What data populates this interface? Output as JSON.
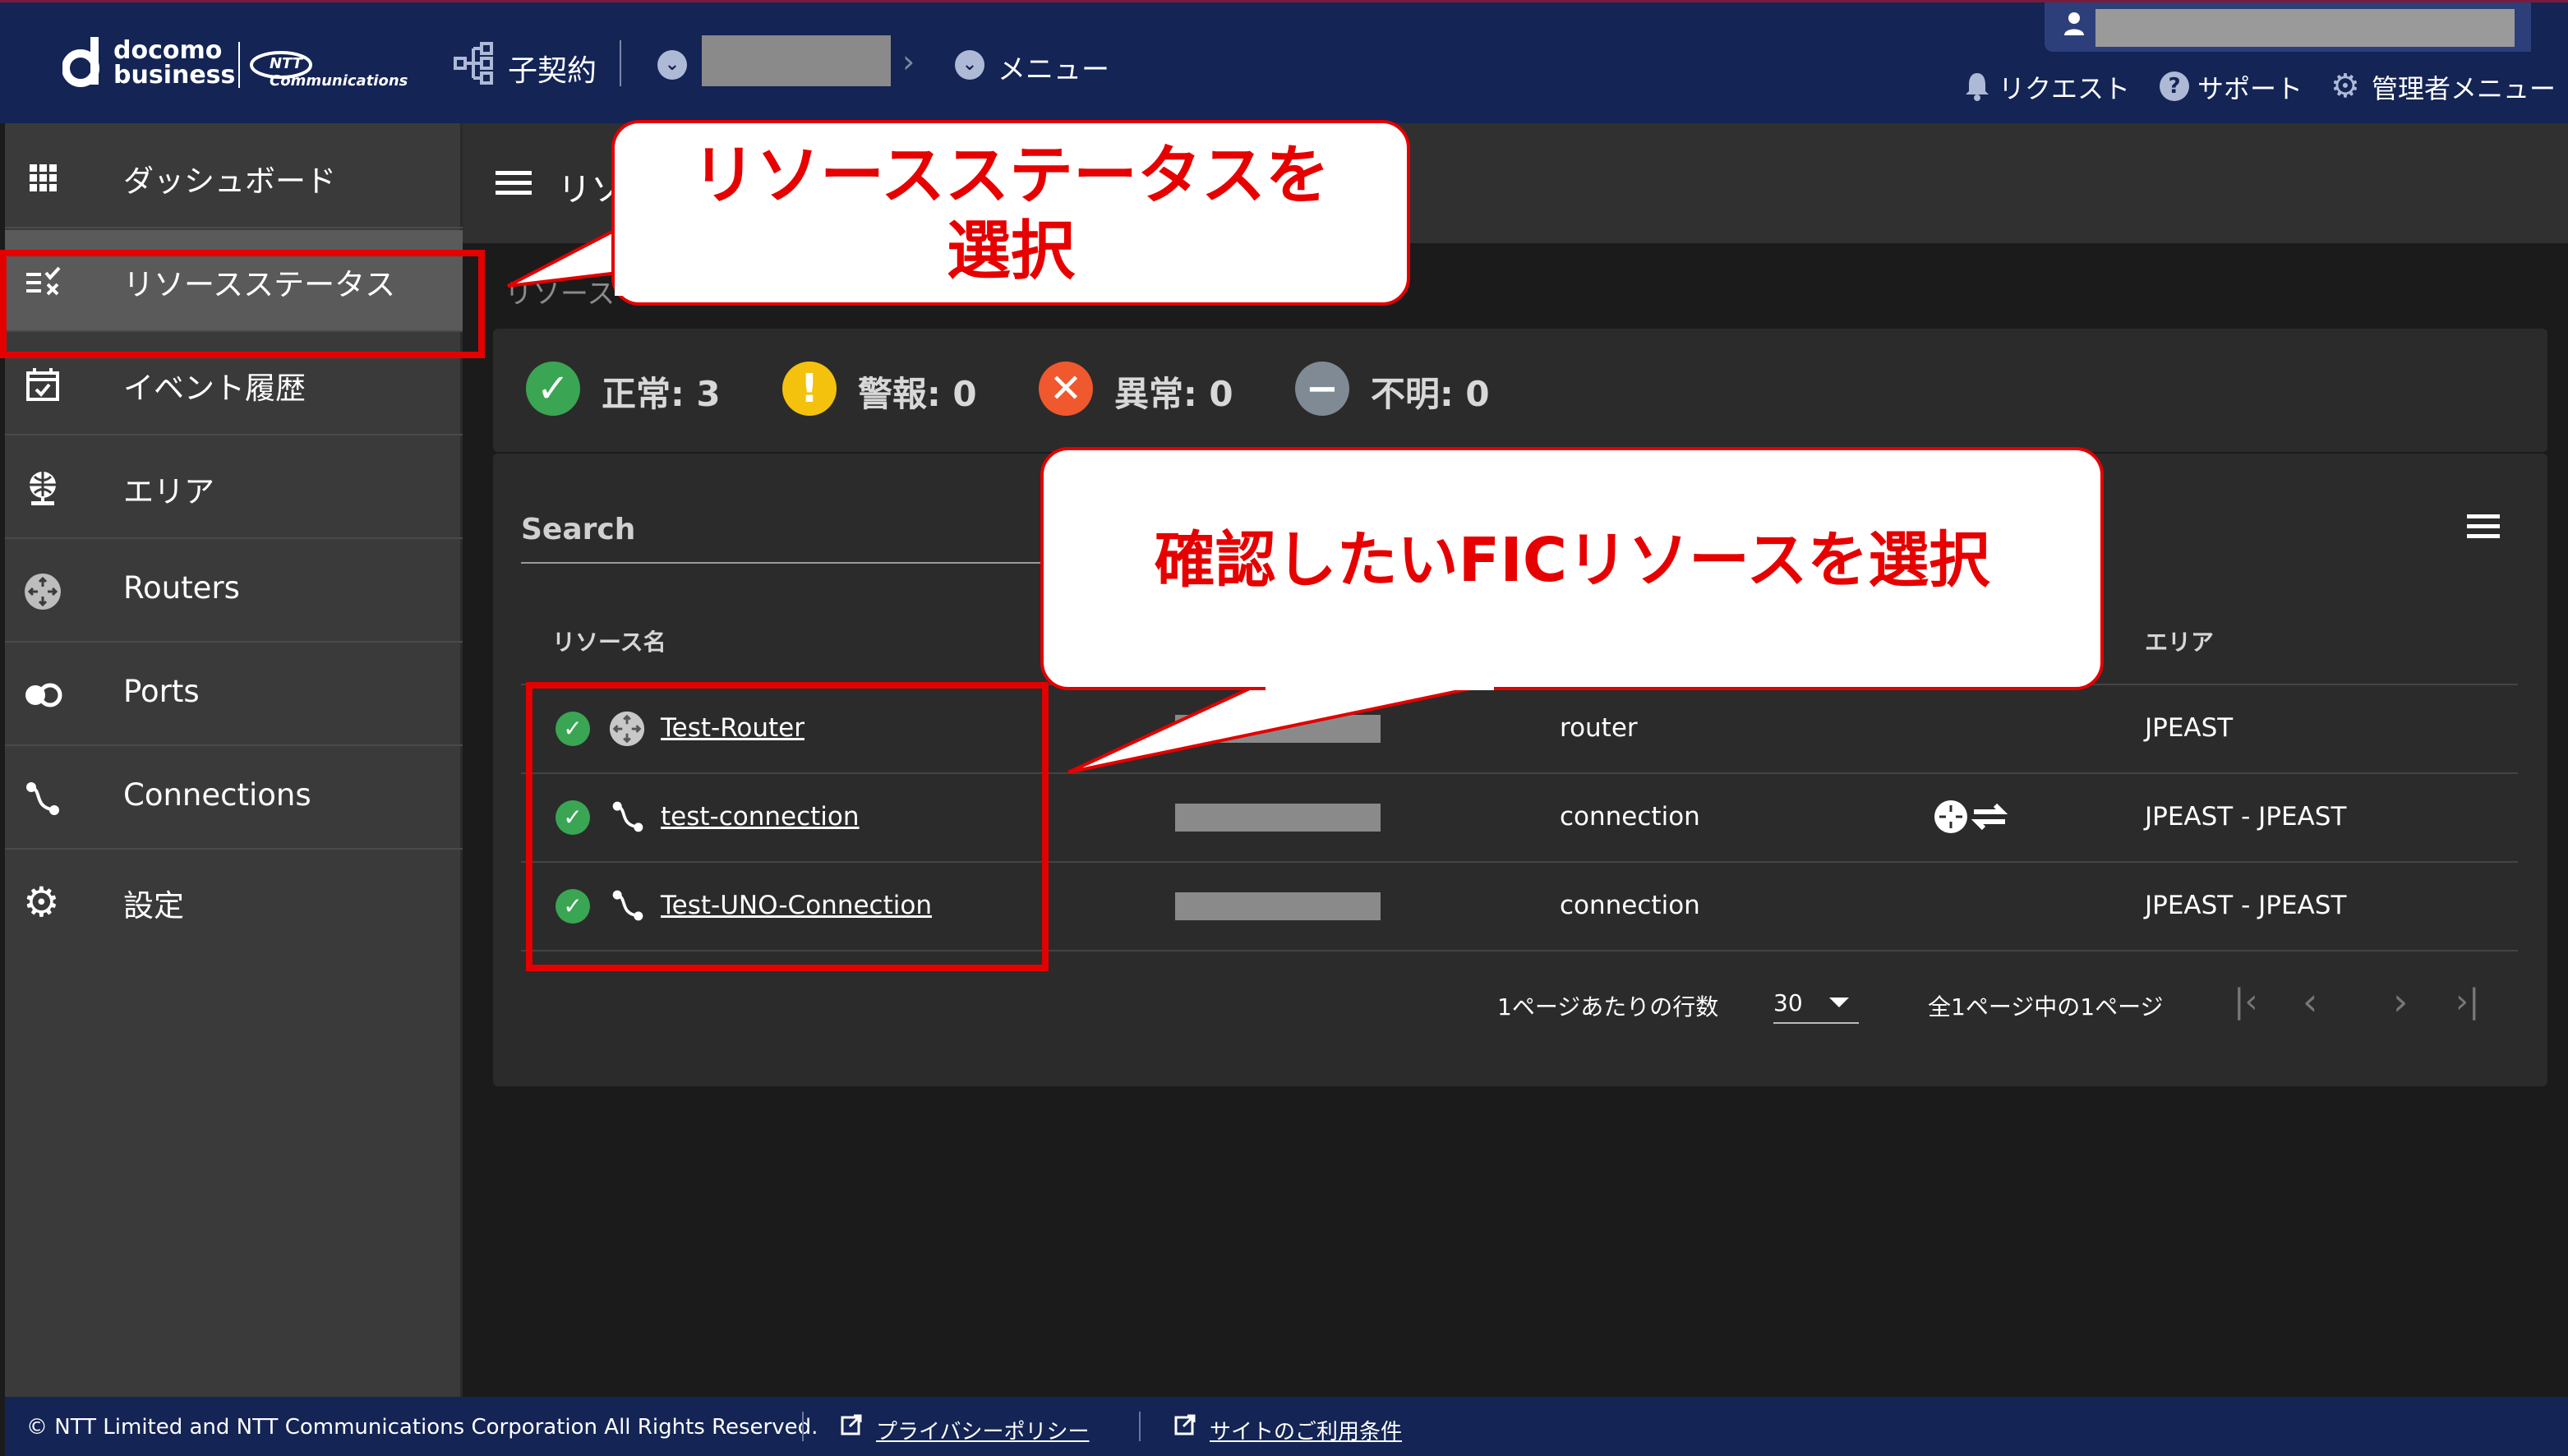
{
  "header": {
    "logo_top": "docomo",
    "logo_bottom": "business",
    "ntt_logo_text": "NTT Communications",
    "sub_contract": "子契約",
    "menu": "メニュー",
    "request": "リクエスト",
    "support": "サポート",
    "admin_menu": "管理者メニュー"
  },
  "sidebar": {
    "items": [
      {
        "label": "ダッシュボード"
      },
      {
        "label": "リソースステータス"
      },
      {
        "label": "イベント履歴"
      },
      {
        "label": "エリア"
      },
      {
        "label": "Routers"
      },
      {
        "label": "Ports"
      },
      {
        "label": "Connections"
      },
      {
        "label": "設定"
      }
    ]
  },
  "main": {
    "page_title": "リソ",
    "breadcrumb": "リソース",
    "status_counts": [
      {
        "label": "正常: 3",
        "color": "#3aa553"
      },
      {
        "label": "警報: 0",
        "color": "#f4c20d"
      },
      {
        "label": "異常: 0",
        "color": "#f0582d"
      },
      {
        "label": "不明: 0",
        "color": "#7f8a94"
      }
    ],
    "search_placeholder": "Search",
    "columns": {
      "name": "リソース名",
      "area": "エリア"
    },
    "rows": [
      {
        "name": "Test-Router",
        "type": "router",
        "area": "JPEAST"
      },
      {
        "name": "test-connection",
        "type": "connection",
        "area": "JPEAST - JPEAST"
      },
      {
        "name": "Test-UNO-Connection",
        "type": "connection",
        "area": "JPEAST - JPEAST"
      }
    ],
    "pagination": {
      "rows_per_page_label": "1ページあたりの行数",
      "rows_per_page": "30",
      "page_info": "全1ページ中の1ページ"
    }
  },
  "callouts": {
    "select_status_line1": "リソースステータスを",
    "select_status_line2": "選択",
    "select_resource": "確認したいFICリソースを選択"
  },
  "footer": {
    "copyright": "© NTT Limited and NTT Communications Corporation All Rights Reserved.",
    "privacy": "プライバシーポリシー",
    "terms": "サイトのご利用条件"
  }
}
